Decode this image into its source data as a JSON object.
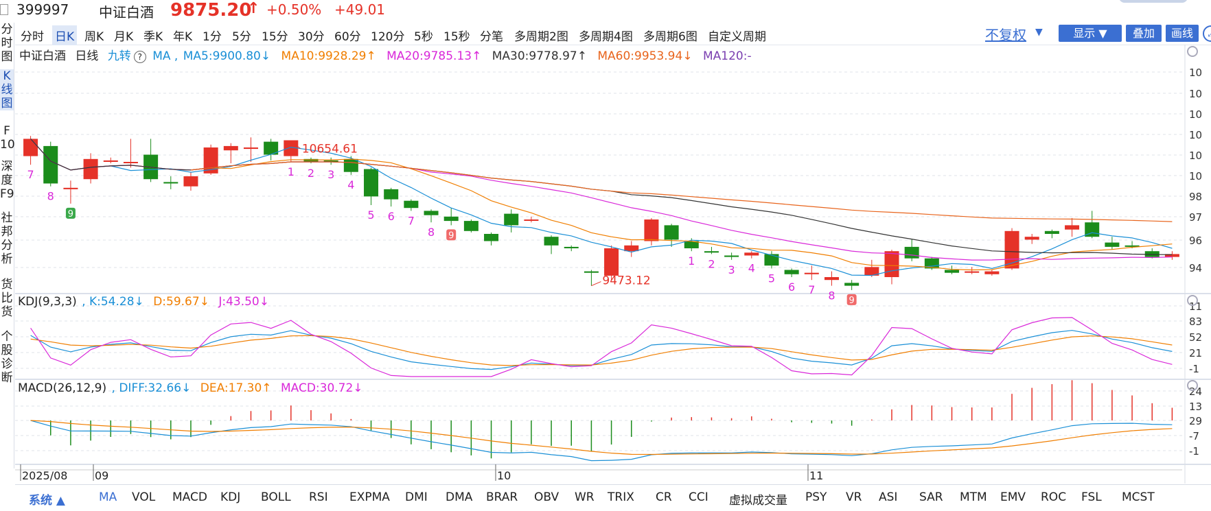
{
  "quote": {
    "code": "399997",
    "name": "中证白酒",
    "price": "9875.20",
    "arrow": "↑",
    "pct": "+0.50%",
    "change": "+49.01"
  },
  "colors": {
    "up": "#e53228",
    "down": "#1b8c1b",
    "accent": "#3b6fd2",
    "ma5": "#1a8fd6",
    "ma10": "#f07e00",
    "ma20": "#d928d9",
    "ma30": "#333333",
    "ma60": "#e8641c",
    "ma120": "#7a3fb0"
  },
  "periods": [
    "分时",
    "日K",
    "周K",
    "月K",
    "季K",
    "年K",
    "1分",
    "5分",
    "15分",
    "30分",
    "60分",
    "120分",
    "5秒",
    "15秒",
    "分笔",
    "多周期2图",
    "多周期4图",
    "多周期6图",
    "自定义周期"
  ],
  "active_period": "日K",
  "right_controls": {
    "adjust": "不复权",
    "show": "显示",
    "overlay": "叠加",
    "draw": "画线"
  },
  "left_nav": [
    {
      "label": "分\n时\n图"
    },
    {
      "label": "K\n线\n图"
    },
    {
      "label": "F\n10"
    },
    {
      "label": "深\n度\nF9"
    },
    {
      "label": "社\n邦\n分\n析"
    },
    {
      "label": "货\n比\n货"
    },
    {
      "label": "个\n股\n诊\n断"
    }
  ],
  "main_info": {
    "name": "中证白酒",
    "period": "日线",
    "nine": "九转",
    "help": "?",
    "ma_label": "MA ,",
    "ma5": "MA5:9900.80↓",
    "ma10": "MA10:9928.29↑",
    "ma20": "MA20:9785.13↑",
    "ma30": "MA30:9778.97↑",
    "ma60": "MA60:9953.94↓",
    "ma120": "MA120:-"
  },
  "kdj_info": {
    "label": "KDJ(9,3,3)",
    "k": ", K:54.28↓",
    "d": "D:59.67↓",
    "j": "J:43.50↓"
  },
  "macd_info": {
    "label": "MACD(26,12,9)",
    "diff": ", DIFF:32.66↓",
    "dea": "DEA:17.30↑",
    "macd": "MACD:30.72↓"
  },
  "bottom_indicators": [
    "MA",
    "VOL",
    "MACD",
    "KDJ",
    "BOLL",
    "RSI",
    "EXPMA",
    "DMI",
    "DMA",
    "BRAR",
    "OBV",
    "WR",
    "TRIX",
    "CR",
    "CCI",
    "虚拟成交量",
    "PSY",
    "VR",
    "ASI",
    "SAR",
    "MTM",
    "EMV",
    "ROC",
    "FSL",
    "MCST"
  ],
  "bottom_system": "系统 ▲",
  "chart_data": {
    "type": "candlestick",
    "x_axis_labels": [
      "2025/08",
      "09",
      "10",
      "11"
    ],
    "y_axis_labels_main": [
      "10",
      "10",
      "10",
      "10",
      "10",
      "10",
      "98",
      "97",
      "96",
      "94"
    ],
    "y_axis_labels_kdj": [
      "11",
      "83",
      "52",
      "21",
      "-1"
    ],
    "y_axis_labels_macd": [
      "24",
      "13",
      "29",
      "-7",
      "-1"
    ],
    "price_range": [
      9380,
      10700
    ],
    "high_annotation": "10654.61",
    "low_annotation": "9473.12",
    "candles": [
      [
        10040,
        10160,
        9980,
        10180
      ],
      [
        10110,
        9850,
        9830,
        10140
      ],
      [
        9810,
        9820,
        9710,
        9870
      ],
      [
        9880,
        10020,
        9850,
        10060
      ],
      [
        10000,
        10010,
        9990,
        10030
      ],
      [
        10000,
        10000,
        9960,
        10160
      ],
      [
        10050,
        9880,
        9860,
        10160
      ],
      [
        9860,
        9850,
        9810,
        9900
      ],
      [
        9830,
        9900,
        9800,
        9930
      ],
      [
        9920,
        10100,
        9910,
        10120
      ],
      [
        10080,
        10110,
        9990,
        10130
      ],
      [
        10090,
        10100,
        10000,
        10170
      ],
      [
        10140,
        10050,
        10010,
        10160
      ],
      [
        10040,
        10150,
        10000,
        10140
      ],
      [
        10020,
        10000,
        9990,
        10030
      ],
      [
        10010,
        10000,
        9980,
        10030
      ],
      [
        10020,
        9930,
        9910,
        10040
      ],
      [
        9950,
        9760,
        9700,
        9960
      ],
      [
        9810,
        9740,
        9690,
        9820
      ],
      [
        9730,
        9680,
        9660,
        9740
      ],
      [
        9660,
        9630,
        9580,
        9670
      ],
      [
        9620,
        9590,
        9560,
        9680
      ],
      [
        9590,
        9520,
        9510,
        9600
      ],
      [
        9500,
        9450,
        9420,
        9510
      ],
      [
        9640,
        9560,
        9510,
        9670
      ],
      [
        9600,
        9600,
        9580,
        9620
      ],
      [
        9480,
        9420,
        9360,
        9490
      ],
      [
        9410,
        9400,
        9380,
        9420
      ],
      [
        9240,
        9230,
        9140,
        9250
      ],
      [
        9210,
        9400,
        9180,
        9420
      ],
      [
        9380,
        9420,
        9340,
        9450
      ],
      [
        9450,
        9600,
        9420,
        9610
      ],
      [
        9560,
        9460,
        9410,
        9570
      ],
      [
        9450,
        9400,
        9380,
        9470
      ],
      [
        9380,
        9370,
        9360,
        9410
      ],
      [
        9350,
        9340,
        9320,
        9370
      ],
      [
        9350,
        9370,
        9330,
        9380
      ],
      [
        9360,
        9280,
        9260,
        9380
      ],
      [
        9250,
        9220,
        9200,
        9260
      ],
      [
        9220,
        9230,
        9180,
        9280
      ],
      [
        9180,
        9200,
        9140,
        9240
      ],
      [
        9160,
        9140,
        9110,
        9180
      ],
      [
        9210,
        9270,
        9200,
        9320
      ],
      [
        9200,
        9380,
        9150,
        9390
      ],
      [
        9410,
        9330,
        9310,
        9460
      ],
      [
        9330,
        9260,
        9250,
        9340
      ],
      [
        9250,
        9230,
        9220,
        9280
      ],
      [
        9230,
        9240,
        9220,
        9270
      ],
      [
        9220,
        9240,
        9210,
        9250
      ],
      [
        9260,
        9520,
        9250,
        9540
      ],
      [
        9460,
        9480,
        9430,
        9500
      ],
      [
        9520,
        9500,
        9470,
        9530
      ],
      [
        9530,
        9560,
        9480,
        9610
      ],
      [
        9580,
        9480,
        9470,
        9660
      ],
      [
        9440,
        9410,
        9390,
        9480
      ],
      [
        9420,
        9410,
        9400,
        9450
      ],
      [
        9380,
        9340,
        9330,
        9400
      ],
      [
        9340,
        9360,
        9320,
        9380
      ]
    ],
    "td_labels": [
      {
        "i": 0,
        "text": "7"
      },
      {
        "i": 1,
        "text": "8"
      },
      {
        "i": 2,
        "text": "9",
        "box": true
      },
      {
        "i": 13,
        "text": "1"
      },
      {
        "i": 14,
        "text": "2"
      },
      {
        "i": 15,
        "text": "3"
      },
      {
        "i": 16,
        "text": "4"
      },
      {
        "i": 17,
        "text": "5"
      },
      {
        "i": 18,
        "text": "6"
      },
      {
        "i": 19,
        "text": "7"
      },
      {
        "i": 20,
        "text": "8"
      },
      {
        "i": 21,
        "text": "9",
        "box": true
      },
      {
        "i": 33,
        "text": "1"
      },
      {
        "i": 34,
        "text": "2"
      },
      {
        "i": 35,
        "text": "3"
      },
      {
        "i": 36,
        "text": "4"
      },
      {
        "i": 37,
        "text": "5"
      },
      {
        "i": 38,
        "text": "6"
      },
      {
        "i": 39,
        "text": "7"
      },
      {
        "i": 40,
        "text": "8"
      },
      {
        "i": 41,
        "text": "9",
        "box": true
      }
    ]
  }
}
